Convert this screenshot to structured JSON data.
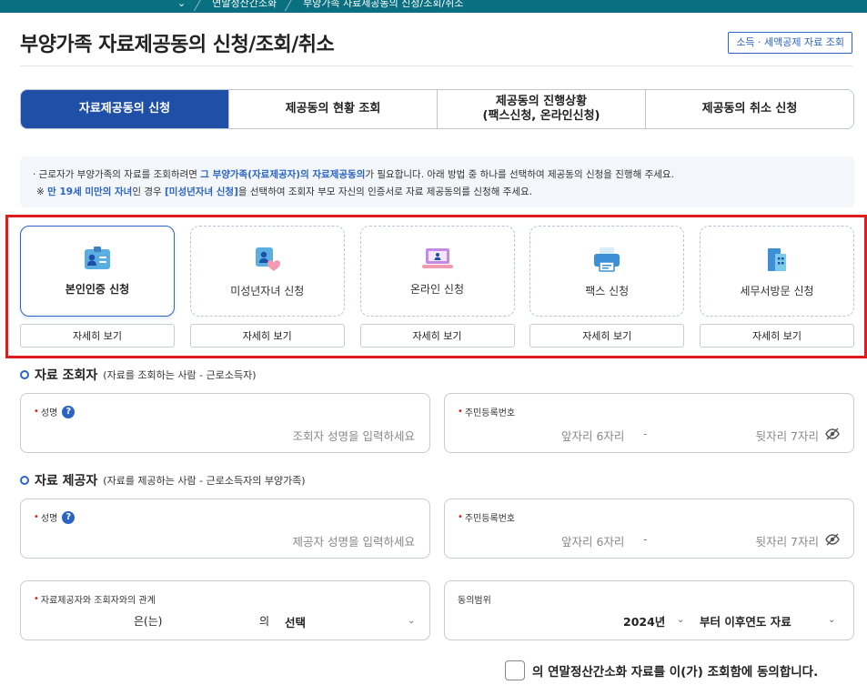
{
  "breadcrumb": {
    "item1": "연말정산간소화",
    "item2": "부양가족 자료제공동의 신청/조회/취소"
  },
  "page": {
    "title": "부양가족 자료제공동의 신청/조회/취소",
    "top_link": "소득 · 세액공제 자료 조회"
  },
  "tabs": [
    {
      "label": "자료제공동의 신청"
    },
    {
      "label": "제공동의 현황 조회"
    },
    {
      "label_line1": "제공동의 진행상황",
      "label_line2": "(팩스신청, 온라인신청)"
    },
    {
      "label": "제공동의 취소 신청"
    }
  ],
  "notice": {
    "line1_a": "· 근로자가 부양가족의 자료를 조회하려면 ",
    "line1_b": "그 부양가족(자료제공자)의 자료제공동의",
    "line1_c": "가 필요합니다. 아래 방법 중 하나를 선택하여 제공동의 신청을 진행해 주세요.",
    "line2_a": "※ ",
    "line2_b": "만 19세 미만의 자녀",
    "line2_c": "인 경우 ",
    "line2_d": "[미성년자녀 신청]",
    "line2_e": "을 선택하여 조회자 부모 자신의 인증서로 자료 제공동의를 신청해 주세요."
  },
  "methods": [
    {
      "label": "본인인증 신청",
      "detail": "자세히 보기",
      "icon": "id-card-icon"
    },
    {
      "label": "미성년자녀 신청",
      "detail": "자세히 보기",
      "icon": "child-heart-icon"
    },
    {
      "label": "온라인 신청",
      "detail": "자세히 보기",
      "icon": "laptop-icon"
    },
    {
      "label": "팩스 신청",
      "detail": "자세히 보기",
      "icon": "fax-icon"
    },
    {
      "label": "세무서방문 신청",
      "detail": "자세히 보기",
      "icon": "building-icon"
    }
  ],
  "viewer": {
    "title": "자료 조회자",
    "subtitle": "(자료를 조회하는 사람 - 근로소득자)",
    "name_label": "성명",
    "name_placeholder": "조회자 성명을 입력하세요",
    "ssn_label": "주민등록번호",
    "ssn_front": "앞자리 6자리",
    "ssn_dash": "-",
    "ssn_back": "뒷자리 7자리"
  },
  "provider": {
    "title": "자료 제공자",
    "subtitle": "(자료를 제공하는 사람 - 근로소득자의 부양가족)",
    "name_label": "성명",
    "name_placeholder": "제공자 성명을 입력하세요",
    "ssn_label": "주민등록번호",
    "ssn_front": "앞자리 6자리",
    "ssn_dash": "-",
    "ssn_back": "뒷자리 7자리"
  },
  "relation": {
    "label": "자료제공자와 조회자와의 관계",
    "text_a": "은(는)",
    "text_b": "의",
    "select_value": "선택"
  },
  "scope": {
    "label": "동의범위",
    "year": "2024년",
    "text": "부터 이후연도 자료"
  },
  "consent": {
    "text": "의 연말정산간소화 자료를 이(가) 조회함에 동의합니다."
  },
  "colors": {
    "primary": "#1f4fa6",
    "accent": "#2a64c5",
    "highlight_border": "#e01d1d",
    "topbar": "#0a6f80"
  }
}
